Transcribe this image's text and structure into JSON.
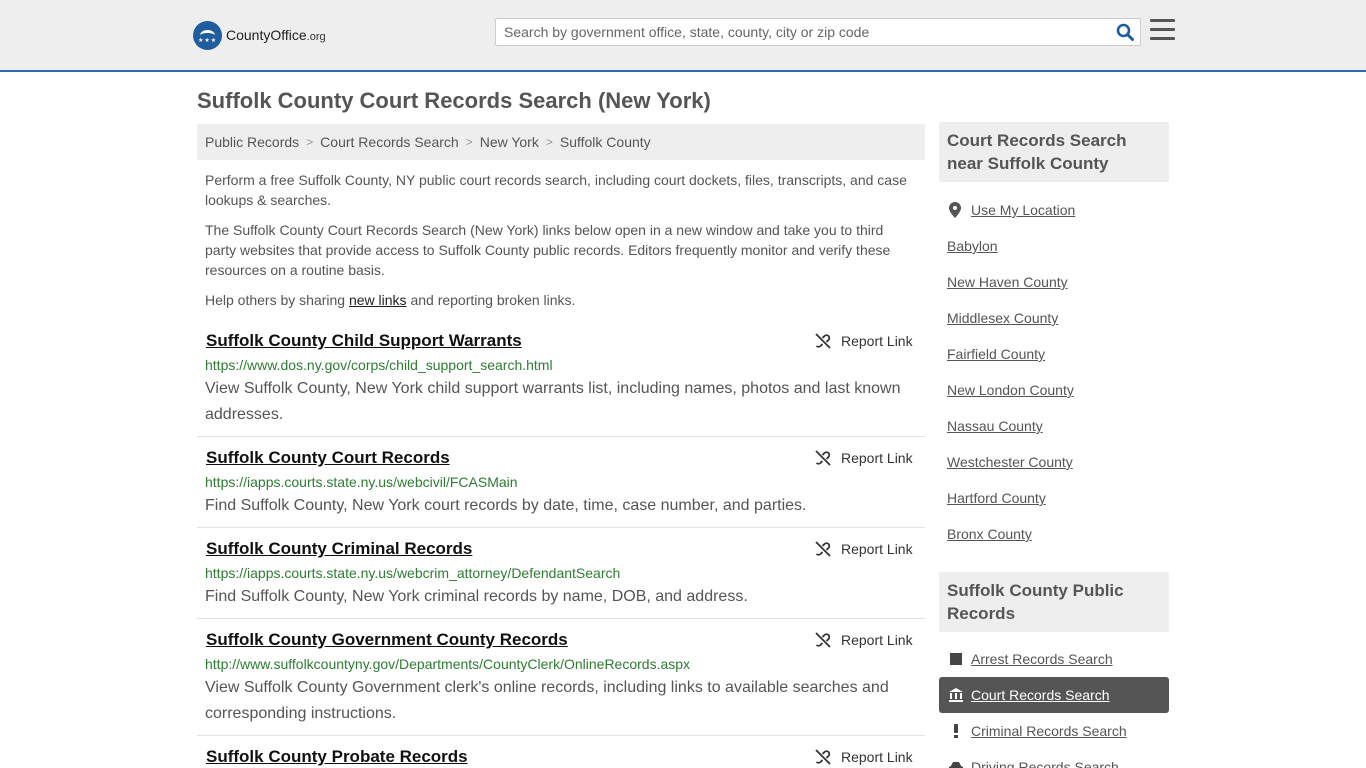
{
  "header": {
    "logo_name": "CountyOffice",
    "logo_tld": ".org",
    "search_placeholder": "Search by government office, state, county, city or zip code"
  },
  "page_title": "Suffolk County Court Records Search (New York)",
  "breadcrumb": [
    "Public Records",
    "Court Records Search",
    "New York",
    "Suffolk County"
  ],
  "intro": {
    "p1": "Perform a free Suffolk County, NY public court records search, including court dockets, files, transcripts, and case lookups & searches.",
    "p2": "The Suffolk County Court Records Search (New York) links below open in a new window and take you to third party websites that provide access to Suffolk County public records. Editors frequently monitor and verify these resources on a routine basis.",
    "p3_before": "Help others by sharing ",
    "p3_link": "new links",
    "p3_after": " and reporting broken links."
  },
  "report_label": "Report Link",
  "entries": [
    {
      "title": "Suffolk County Child Support Warrants",
      "url": "https://www.dos.ny.gov/corps/child_support_search.html",
      "desc": "View Suffolk County, New York child support warrants list, including names, photos and last known addresses."
    },
    {
      "title": "Suffolk County Court Records",
      "url": "https://iapps.courts.state.ny.us/webcivil/FCASMain",
      "desc": "Find Suffolk County, New York court records by date, time, case number, and parties."
    },
    {
      "title": "Suffolk County Criminal Records",
      "url": "https://iapps.courts.state.ny.us/webcrim_attorney/DefendantSearch",
      "desc": "Find Suffolk County, New York criminal records by name, DOB, and address."
    },
    {
      "title": "Suffolk County Government County Records",
      "url": "http://www.suffolkcountyny.gov/Departments/CountyClerk/OnlineRecords.aspx",
      "desc": "View Suffolk County Government clerk's online records, including links to available searches and corresponding instructions."
    },
    {
      "title": "Suffolk County Probate Records",
      "url": "",
      "desc": ""
    }
  ],
  "sidebar": {
    "nearby_heading": "Court Records Search near Suffolk County",
    "use_location": "Use My Location",
    "nearby": [
      "Babylon",
      "New Haven County",
      "Middlesex County",
      "Fairfield County",
      "New London County",
      "Nassau County",
      "Westchester County",
      "Hartford County",
      "Bronx County"
    ],
    "public_heading": "Suffolk County Public Records",
    "public_records": [
      {
        "label": "Arrest Records Search",
        "icon": "square-icon",
        "active": false
      },
      {
        "label": "Court Records Search",
        "icon": "courthouse-icon",
        "active": true
      },
      {
        "label": "Criminal Records Search",
        "icon": "exclamation-icon",
        "active": false
      },
      {
        "label": "Driving Records Search",
        "icon": "car-icon",
        "active": false
      }
    ]
  }
}
